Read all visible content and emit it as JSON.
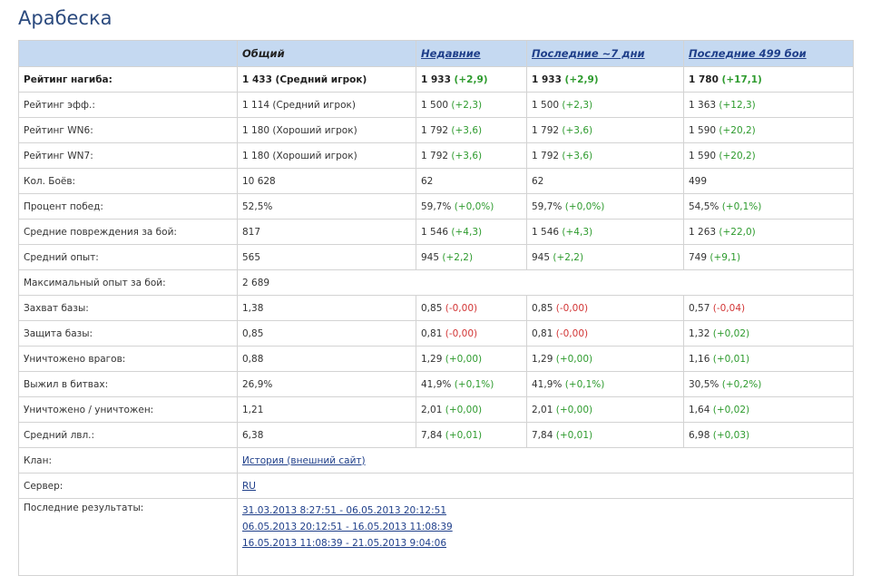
{
  "title": "Арабеска",
  "columns": [
    "",
    "Общий",
    "Недавние",
    "Последние ~7 дни",
    "Последние 499 бои"
  ],
  "rows": [
    {
      "label": "Рейтинг нагиба:",
      "bold": true,
      "cells": [
        {
          "v": "1 433 (Средний игрок)"
        },
        {
          "v": "1 933",
          "d": "(+2,9)",
          "s": "pos"
        },
        {
          "v": "1 933",
          "d": "(+2,9)",
          "s": "pos"
        },
        {
          "v": "1 780",
          "d": "(+17,1)",
          "s": "pos"
        }
      ]
    },
    {
      "label": "Рейтинг эфф.:",
      "cells": [
        {
          "v": "1 114 (Средний игрок)"
        },
        {
          "v": "1 500",
          "d": "(+2,3)",
          "s": "pos"
        },
        {
          "v": "1 500",
          "d": "(+2,3)",
          "s": "pos"
        },
        {
          "v": "1 363",
          "d": "(+12,3)",
          "s": "pos"
        }
      ]
    },
    {
      "label": "Рейтинг WN6:",
      "cells": [
        {
          "v": "1 180 (Хороший игрок)"
        },
        {
          "v": "1 792",
          "d": "(+3,6)",
          "s": "pos"
        },
        {
          "v": "1 792",
          "d": "(+3,6)",
          "s": "pos"
        },
        {
          "v": "1 590",
          "d": "(+20,2)",
          "s": "pos"
        }
      ]
    },
    {
      "label": "Рейтинг WN7:",
      "cells": [
        {
          "v": "1 180 (Хороший игрок)"
        },
        {
          "v": "1 792",
          "d": "(+3,6)",
          "s": "pos"
        },
        {
          "v": "1 792",
          "d": "(+3,6)",
          "s": "pos"
        },
        {
          "v": "1 590",
          "d": "(+20,2)",
          "s": "pos"
        }
      ]
    },
    {
      "label": "Кол. Боёв:",
      "cells": [
        {
          "v": "10 628"
        },
        {
          "v": "62"
        },
        {
          "v": "62"
        },
        {
          "v": "499"
        }
      ]
    },
    {
      "label": "Процент побед:",
      "cells": [
        {
          "v": "52,5%"
        },
        {
          "v": "59,7%",
          "d": "(+0,0%)",
          "s": "pos"
        },
        {
          "v": "59,7%",
          "d": "(+0,0%)",
          "s": "pos"
        },
        {
          "v": "54,5%",
          "d": "(+0,1%)",
          "s": "pos"
        }
      ]
    },
    {
      "label": "Средние повреждения за бой:",
      "cells": [
        {
          "v": "817"
        },
        {
          "v": "1 546",
          "d": "(+4,3)",
          "s": "pos"
        },
        {
          "v": "1 546",
          "d": "(+4,3)",
          "s": "pos"
        },
        {
          "v": "1 263",
          "d": "(+22,0)",
          "s": "pos"
        }
      ]
    },
    {
      "label": "Средний опыт:",
      "cells": [
        {
          "v": "565"
        },
        {
          "v": "945",
          "d": "(+2,2)",
          "s": "pos"
        },
        {
          "v": "945",
          "d": "(+2,2)",
          "s": "pos"
        },
        {
          "v": "749",
          "d": "(+9,1)",
          "s": "pos"
        }
      ]
    },
    {
      "label": "Максимальный опыт за бой:",
      "span": true,
      "cells": [
        {
          "v": "2 689"
        }
      ]
    },
    {
      "label": "Захват базы:",
      "cells": [
        {
          "v": "1,38"
        },
        {
          "v": "0,85",
          "d": "(-0,00)",
          "s": "neg"
        },
        {
          "v": "0,85",
          "d": "(-0,00)",
          "s": "neg"
        },
        {
          "v": "0,57",
          "d": "(-0,04)",
          "s": "neg"
        }
      ]
    },
    {
      "label": "Защита базы:",
      "cells": [
        {
          "v": "0,85"
        },
        {
          "v": "0,81",
          "d": "(-0,00)",
          "s": "neg"
        },
        {
          "v": "0,81",
          "d": "(-0,00)",
          "s": "neg"
        },
        {
          "v": "1,32",
          "d": "(+0,02)",
          "s": "pos"
        }
      ]
    },
    {
      "label": "Уничтожено врагов:",
      "cells": [
        {
          "v": "0,88"
        },
        {
          "v": "1,29",
          "d": "(+0,00)",
          "s": "pos"
        },
        {
          "v": "1,29",
          "d": "(+0,00)",
          "s": "pos"
        },
        {
          "v": "1,16",
          "d": "(+0,01)",
          "s": "pos"
        }
      ]
    },
    {
      "label": "Выжил в битвах:",
      "cells": [
        {
          "v": "26,9%"
        },
        {
          "v": "41,9%",
          "d": "(+0,1%)",
          "s": "pos"
        },
        {
          "v": "41,9%",
          "d": "(+0,1%)",
          "s": "pos"
        },
        {
          "v": "30,5%",
          "d": "(+0,2%)",
          "s": "pos"
        }
      ]
    },
    {
      "label": "Уничтожено / уничтожен:",
      "cells": [
        {
          "v": "1,21"
        },
        {
          "v": "2,01",
          "d": "(+0,00)",
          "s": "pos"
        },
        {
          "v": "2,01",
          "d": "(+0,00)",
          "s": "pos"
        },
        {
          "v": "1,64",
          "d": "(+0,02)",
          "s": "pos"
        }
      ]
    },
    {
      "label": "Средний лвл.:",
      "cells": [
        {
          "v": "6,38"
        },
        {
          "v": "7,84",
          "d": "(+0,01)",
          "s": "pos"
        },
        {
          "v": "7,84",
          "d": "(+0,01)",
          "s": "pos"
        },
        {
          "v": "6,98",
          "d": "(+0,03)",
          "s": "pos"
        }
      ]
    }
  ],
  "clan": {
    "label": "Клан:",
    "link": "История (внешний сайт)"
  },
  "server": {
    "label": "Сервер:",
    "link": "RU"
  },
  "results": {
    "label": "Последние результаты:",
    "links": [
      "31.03.2013 8:27:51 - 06.05.2013 20:12:51",
      "06.05.2013 20:12:51 - 16.05.2013 11:08:39",
      "16.05.2013 11:08:39 - 21.05.2013 9:04:06"
    ]
  },
  "colors": {
    "header_bg": "#c5d9f1",
    "title": "#2b4a7e",
    "positive": "#2e9b2e",
    "negative": "#d23535",
    "link": "#1f3f8a"
  }
}
